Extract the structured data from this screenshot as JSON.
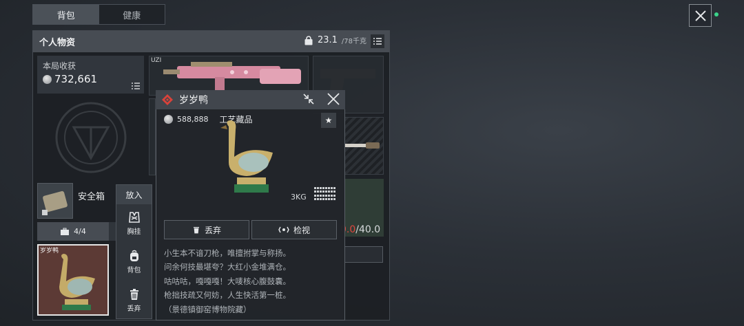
{
  "tabs": [
    {
      "label": "背包",
      "active": true
    },
    {
      "label": "健康",
      "active": false
    }
  ],
  "panel": {
    "title": "个人物资",
    "weight_current": "23.1",
    "weight_max": "/78千克"
  },
  "harvest": {
    "label": "本局收获",
    "value": "732,661"
  },
  "slots": {
    "primary_tag": "UZI",
    "ammo_current": "0.0",
    "ammo_max": "/40.0"
  },
  "safebox": {
    "label": "安全箱",
    "capacity": "4/4"
  },
  "put_menu": {
    "header": "放入",
    "items": [
      {
        "label": "胸挂",
        "icon": "vest-icon"
      },
      {
        "label": "背包",
        "icon": "backpack-icon"
      },
      {
        "label": "丢弃",
        "icon": "trash-icon"
      }
    ]
  },
  "selected_card": {
    "label": "岁岁鸭"
  },
  "popup": {
    "title": "岁岁鸭",
    "price": "588,888",
    "category": "工艺藏品",
    "weight": "3KG",
    "discard_label": "丢弃",
    "inspect_label": "检视",
    "description": [
      "小生本不谙刀枪，唯擅拊掌与称扬。",
      "问余何技最堪夸？大红小金堆满仓。",
      "咕咕咕，嘎嘎嘎！大唛核心腹鼓囊。",
      "枪拙技疏又何妨，人生快活第一桩。",
      "（景德镇御窑博物院藏）"
    ]
  },
  "colors": {
    "accent_red": "#e0473e",
    "status_green": "#3bd48a",
    "rarity_red": "#d9423a"
  }
}
